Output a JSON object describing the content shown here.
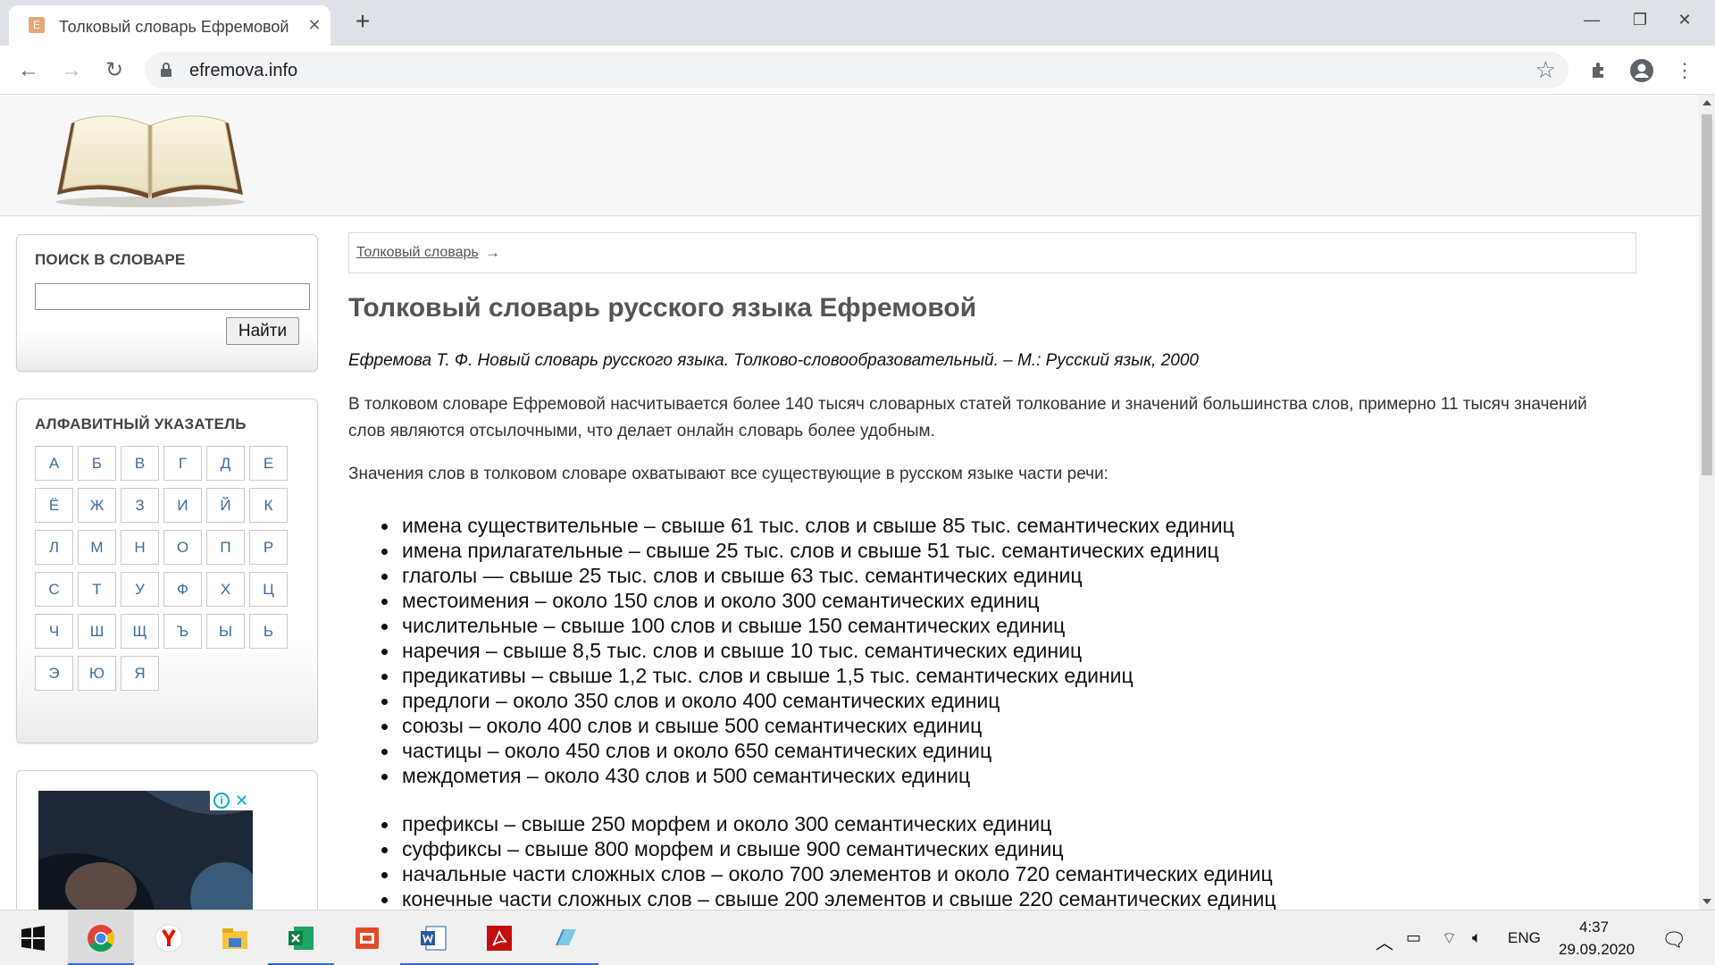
{
  "browser": {
    "tab_title": "Толковый словарь Ефремовой",
    "tab_favicon": "Е",
    "url": "efremova.info",
    "new_tab_symbol": "+",
    "window_controls": {
      "minimize": "—",
      "restore": "❐",
      "close": "✕"
    }
  },
  "sidebar": {
    "search": {
      "title": "ПОИСК В СЛОВАРЕ",
      "input_value": "",
      "button_label": "Найти"
    },
    "alphabet": {
      "title": "АЛФАВИТНЫЙ УКАЗАТЕЛЬ",
      "letters": [
        "А",
        "Б",
        "В",
        "Г",
        "Д",
        "Е",
        "Ё",
        "Ж",
        "З",
        "И",
        "Й",
        "К",
        "Л",
        "М",
        "Н",
        "О",
        "П",
        "Р",
        "С",
        "Т",
        "У",
        "Ф",
        "Х",
        "Ц",
        "Ч",
        "Ш",
        "Щ",
        "Ъ",
        "Ы",
        "Ь",
        "Э",
        "Ю",
        "Я"
      ]
    }
  },
  "main": {
    "breadcrumb": {
      "link": "Толковый словарь",
      "arrow": "→"
    },
    "title": "Толковый словарь русского языка Ефремовой",
    "citation": "Ефремова Т. Ф. Новый словарь русского языка. Толково-словообразовательный. – М.: Русский язык, 2000",
    "intro": "В толковом словаре Ефремовой насчитывается более 140 тысяч словарных статей толкование и значений большинства слов, примерно 11 тысяч значений слов являются отсылочными, что делает онлайн словарь более удобным.",
    "parts_intro": "Значения слов в толковом словаре охватывают все существующие в русском языке части речи:",
    "parts_of_speech": [
      "имена существительные – свыше 61 тыс. слов и свыше 85 тыс. семантических единиц",
      "имена прилагательные – свыше 25 тыс. слов и свыше 51 тыс. семантических единиц",
      "глаголы — свыше 25 тыс. слов и свыше 63 тыс. семантических единиц",
      "местоимения – около 150 слов и около 300 семантических единиц",
      "числительные – свыше 100 слов и свыше 150 семантических единиц",
      "наречия – свыше 8,5 тыс. слов и свыше 10 тыс. семантических единиц",
      "предикативы – свыше 1,2 тыс. слов и свыше 1,5 тыс. семантических единиц",
      "предлоги – около 350 слов и около 400 семантических единиц",
      "союзы – около 400 слов и свыше 500 семантических единиц",
      "частицы – около 450 слов и около 650 семантических единиц",
      "междометия – около 430 слов и 500 семантических единиц"
    ],
    "morphemes": [
      "префиксы – свыше 250 морфем и около 300 семантических единиц",
      "суффиксы – свыше 800 морфем и свыше 900 семантических единиц",
      "начальные части сложных слов – около 700 элементов и около 720 семантических единиц",
      "конечные части сложных слов – свыше 200 элементов и свыше 220 семантических единиц"
    ]
  },
  "ad": {
    "info_icon": "i",
    "close_icon": "✕"
  },
  "taskbar": {
    "apps": [
      "windows-start-icon",
      "chrome-icon",
      "yandex-browser-icon",
      "file-explorer-icon",
      "excel-icon",
      "powerpoint-icon",
      "word-icon",
      "acrobat-icon",
      "app-icon"
    ],
    "language": "ENG",
    "time": "4:37",
    "date": "29.09.2020"
  },
  "colors": {
    "link": "#3d6a9b",
    "header_bg": "#f7f7f7",
    "taskbar_accent": "#2f6bd0"
  }
}
